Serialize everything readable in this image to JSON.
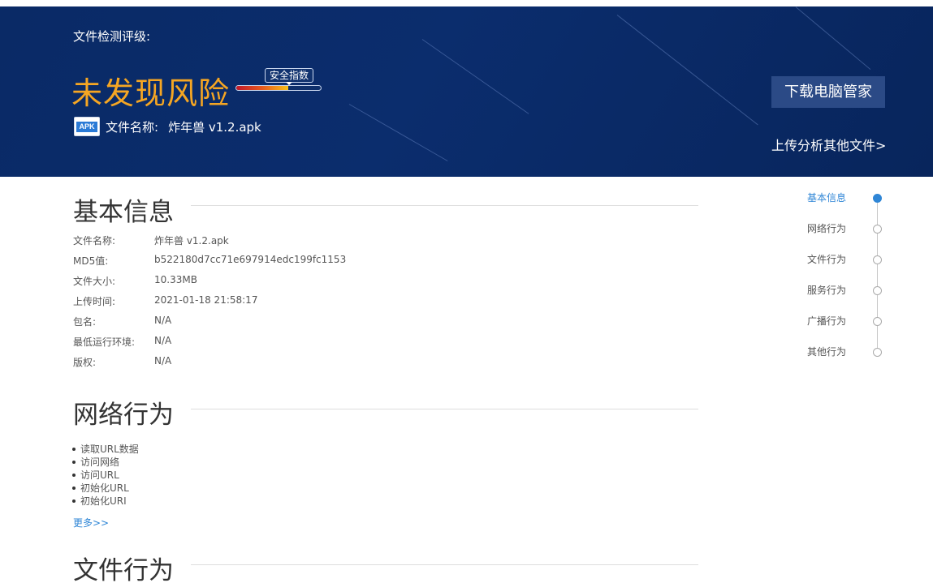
{
  "banner": {
    "rating_label": "文件检测评级:",
    "verdict": "未发现风险",
    "gauge_label": "安全指数",
    "gauge_level_fraction": 0.62,
    "apk_badge": "APK",
    "filename_label": "文件名称:",
    "filename_value": "炸年兽 v1.2.apk",
    "download_button": "下载电脑管家",
    "upload_link": "上传分析其他文件>"
  },
  "sections": {
    "basic_info": "基本信息",
    "network": "网络行为",
    "file": "文件行为"
  },
  "basic_info_rows": [
    {
      "key": "文件名称:",
      "value": "炸年兽 v1.2.apk"
    },
    {
      "key": "MD5值:",
      "value": "b522180d7cc71e697914edc199fc1153"
    },
    {
      "key": "文件大小:",
      "value": "10.33MB"
    },
    {
      "key": "上传时间:",
      "value": "2021-01-18 21:58:17"
    },
    {
      "key": "包名:",
      "value": "N/A"
    },
    {
      "key": "最低运行环境:",
      "value": "N/A"
    },
    {
      "key": "版权:",
      "value": "N/A"
    }
  ],
  "network_items": [
    "读取URL数据",
    "访问网络",
    "访问URL",
    "初始化URL",
    "初始化URI"
  ],
  "more_link": "更多>>",
  "side_nav": [
    {
      "label": "基本信息",
      "active": true
    },
    {
      "label": "网络行为",
      "active": false
    },
    {
      "label": "文件行为",
      "active": false
    },
    {
      "label": "服务行为",
      "active": false
    },
    {
      "label": "广播行为",
      "active": false
    },
    {
      "label": "其他行为",
      "active": false
    }
  ],
  "colors": {
    "banner_bg": "#0b2d6d",
    "verdict": "#f5a623",
    "accent_blue": "#2f86d6",
    "button_bg": "#2b4a86"
  }
}
